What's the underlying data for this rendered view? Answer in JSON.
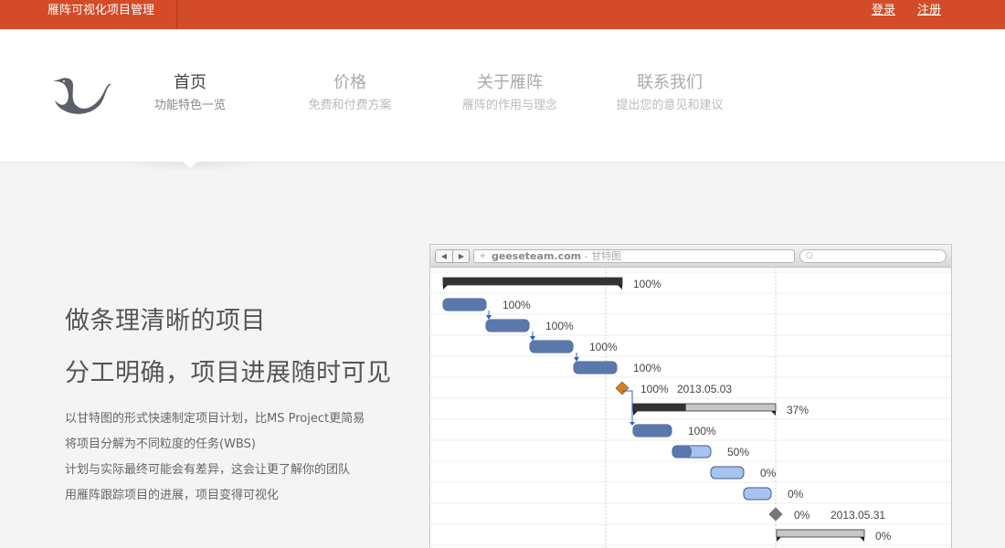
{
  "topbar": {
    "brand": "雁阵可视化项目管理",
    "login": "登录",
    "register": "注册"
  },
  "nav": [
    {
      "title": "首页",
      "subtitle": "功能特色一览",
      "active": true
    },
    {
      "title": "价格",
      "subtitle": "免费和付费方案",
      "active": false
    },
    {
      "title": "关于雁阵",
      "subtitle": "雁阵的作用与理念",
      "active": false
    },
    {
      "title": "联系我们",
      "subtitle": "提出您的意见和建议",
      "active": false
    }
  ],
  "hero": {
    "heading1": "做条理清晰的项目",
    "heading2": "分工明确，项目进展随时可见",
    "lines": [
      "以甘特图的形式快速制定项目计划，比MS Project更简易",
      "将项目分解为不同粒度的任务(WBS)",
      "计划与实际最终可能会有差异，这会让更了解你的团队",
      "用雁阵跟踪项目的进展，项目变得可视化"
    ]
  },
  "browser": {
    "back_icon": "back-arrow-icon",
    "forward_icon": "forward-arrow-icon",
    "url_domain": "geeseteam.com",
    "url_separator": " - ",
    "page_title": "甘特图",
    "search_icon": "magnifier-icon"
  },
  "gantt": {
    "tasks": [
      {
        "kind": "summary",
        "label": "100%"
      },
      {
        "kind": "task",
        "label": "100%"
      },
      {
        "kind": "task",
        "label": "100%"
      },
      {
        "kind": "task",
        "label": "100%"
      },
      {
        "kind": "task",
        "label": "100%"
      },
      {
        "kind": "milestone",
        "label": "100%",
        "date": "2013.05.03"
      },
      {
        "kind": "summary",
        "label": "37%"
      },
      {
        "kind": "task",
        "label": "100%"
      },
      {
        "kind": "task",
        "label": "50%"
      },
      {
        "kind": "task",
        "label": "0%"
      },
      {
        "kind": "task",
        "label": "0%"
      },
      {
        "kind": "milestone",
        "label": "0%",
        "date": "2013.05.31"
      },
      {
        "kind": "summary",
        "label": "0%"
      }
    ],
    "colors": {
      "done": "#5b78ad",
      "todo": "#a9c3ef",
      "summary_done": "#333333",
      "summary_todo": "#c7c7c7",
      "milestone_done": "#e07b1a",
      "milestone_todo": "#777777",
      "link": "#2a64c8"
    }
  }
}
